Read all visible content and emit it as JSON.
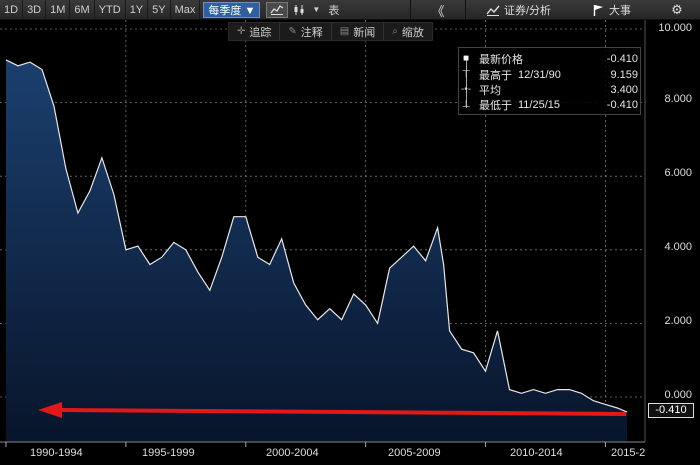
{
  "toolbar": {
    "ranges": [
      "1D",
      "3D",
      "1M",
      "6M",
      "YTD",
      "1Y",
      "5Y",
      "Max"
    ],
    "period": "每季度",
    "table_label": "表",
    "analysis_label": "证券/分析",
    "events_label": "大事"
  },
  "annotations": {
    "track": "追踪",
    "notes": "注释",
    "news": "新闻",
    "zoom": "缩放"
  },
  "legend": {
    "last_label": "最新价格",
    "last_value": "-0.410",
    "high_label": "最高于",
    "high_date": "12/31/90",
    "high_value": "9.159",
    "avg_label": "平均",
    "avg_value": "3.400",
    "low_label": "最低于",
    "low_date": "11/25/15",
    "low_value": "-0.410"
  },
  "axis": {
    "y_ticks": [
      "10.000",
      "8.000",
      "6.000",
      "4.000",
      "2.000",
      "0.000"
    ],
    "x_ticks": [
      "1990-1994",
      "1995-1999",
      "2000-2004",
      "2005-2009",
      "2010-2014",
      "2015-2"
    ],
    "last_tag": "-0.410"
  },
  "colors": {
    "line": "#e8e8e8",
    "fill_top": "#1b3f6e",
    "fill_bottom": "#08152b",
    "arrow": "#e01818",
    "grid": "#7a7a7a"
  },
  "chart_data": {
    "type": "area",
    "ylim": [
      -0.6,
      10.0
    ],
    "x": [
      1990.0,
      1990.5,
      1991.0,
      1991.5,
      1992.0,
      1992.5,
      1993.0,
      1993.5,
      1994.0,
      1994.5,
      1995.0,
      1995.5,
      1996.0,
      1996.5,
      1997.0,
      1997.5,
      1998.0,
      1998.5,
      1999.0,
      1999.5,
      2000.0,
      2000.5,
      2001.0,
      2001.5,
      2002.0,
      2002.5,
      2003.0,
      2003.5,
      2004.0,
      2004.5,
      2005.0,
      2005.5,
      2006.0,
      2006.5,
      2007.0,
      2007.5,
      2008.0,
      2008.25,
      2008.5,
      2009.0,
      2009.5,
      2010.0,
      2010.5,
      2011.0,
      2011.5,
      2012.0,
      2012.5,
      2013.0,
      2013.5,
      2014.0,
      2014.5,
      2015.0,
      2015.5,
      2015.9
    ],
    "y": [
      9.159,
      9.0,
      9.1,
      8.9,
      7.9,
      6.2,
      5.0,
      5.6,
      6.5,
      5.5,
      4.0,
      4.1,
      3.6,
      3.8,
      4.2,
      4.0,
      3.4,
      2.9,
      3.8,
      4.9,
      4.9,
      3.8,
      3.6,
      4.3,
      3.1,
      2.5,
      2.1,
      2.4,
      2.1,
      2.8,
      2.5,
      2.0,
      3.5,
      3.8,
      4.1,
      3.7,
      4.6,
      3.6,
      1.8,
      1.3,
      1.2,
      0.7,
      1.8,
      0.2,
      0.1,
      0.2,
      0.1,
      0.2,
      0.2,
      0.1,
      -0.1,
      -0.2,
      -0.3,
      -0.41
    ],
    "ytick_values": [
      10,
      8,
      6,
      4,
      2,
      0
    ]
  }
}
